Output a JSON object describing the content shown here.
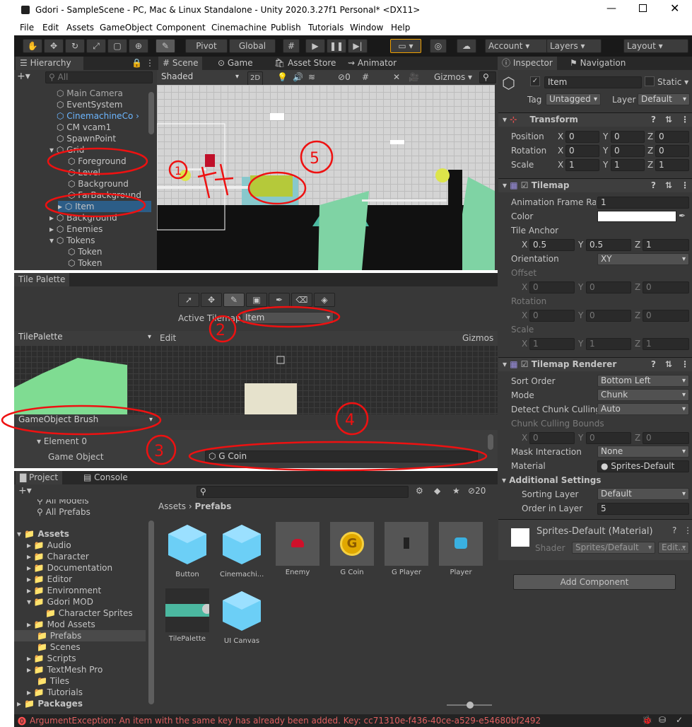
{
  "title": "Gdori - SampleScene - PC, Mac & Linux Standalone - Unity 2020.3.27f1 Personal* <DX11>",
  "menu": [
    "File",
    "Edit",
    "Assets",
    "GameObject",
    "Component",
    "Cinemachine",
    "Publish",
    "Tutorials",
    "Window",
    "Help"
  ],
  "toolbar": {
    "pivot": "Pivot",
    "global": "Global",
    "account": "Account",
    "layers": "Layers",
    "layout": "Layout"
  },
  "hierarchy": {
    "tab": "Hierarchy",
    "search": "All",
    "items": [
      "Main Camera",
      "EventSystem",
      "CinemachineCo",
      "CM vcam1",
      "SpawnPoint",
      "Grid",
      "Foreground",
      "Level",
      "Background",
      "FarBackground",
      "Item",
      "Background",
      "Enemies",
      "Tokens",
      "Token",
      "Token"
    ]
  },
  "scene": {
    "tabs": [
      "Scene",
      "Game",
      "Asset Store",
      "Animator"
    ],
    "shaded": "Shaded",
    "mode2d": "2D",
    "gizmos": "Gizmos",
    "hidden": "0"
  },
  "palette": {
    "tab": "Tile Palette",
    "active_label": "Active Tilemap",
    "active_value": "Item",
    "palette_name": "TilePalette",
    "edit": "Edit",
    "gizmos": "Gizmos",
    "brush": "GameObject Brush",
    "element": "Element 0",
    "game_object_label": "Game Object",
    "game_object_value": "G Coin"
  },
  "project": {
    "tabs": [
      "Project",
      "Console"
    ],
    "count": "20",
    "tree": [
      "All Models",
      "All Prefabs",
      "Assets",
      "Audio",
      "Character",
      "Documentation",
      "Editor",
      "Environment",
      "Gdori MOD",
      "Character Sprites",
      "Mod Assets",
      "Prefabs",
      "Scenes",
      "Scripts",
      "TextMesh Pro",
      "Tiles",
      "Tutorials",
      "Packages"
    ],
    "breadcrumb_root": "Assets",
    "breadcrumb_leaf": "Prefabs",
    "assets": [
      "Button",
      "Cinemachi...",
      "Enemy",
      "G Coin",
      "G Player",
      "Player",
      "TilePalette",
      "UI Canvas"
    ]
  },
  "inspector": {
    "tabs": [
      "Inspector",
      "Navigation"
    ],
    "name": "Item",
    "static": "Static",
    "tag_label": "Tag",
    "tag": "Untagged",
    "layer_label": "Layer",
    "layer": "Default",
    "transform": {
      "title": "Transform",
      "position": "Position",
      "rotation": "Rotation",
      "scale": "Scale",
      "pos": [
        "0",
        "0",
        "0"
      ],
      "rot": [
        "0",
        "0",
        "0"
      ],
      "scl": [
        "1",
        "1",
        "1"
      ]
    },
    "tilemap": {
      "title": "Tilemap",
      "anim_label": "Animation Frame Rate",
      "anim": "1",
      "color_label": "Color",
      "anchor_label": "Tile Anchor",
      "anchor": [
        "0.5",
        "0.5",
        "1"
      ],
      "orientation_label": "Orientation",
      "orientation": "XY",
      "offset_label": "Offset",
      "offset": [
        "0",
        "0",
        "0"
      ],
      "rotation_label": "Rotation",
      "rotation": [
        "0",
        "0",
        "0"
      ],
      "scale_label": "Scale",
      "scale": [
        "1",
        "1",
        "1"
      ]
    },
    "renderer": {
      "title": "Tilemap Renderer",
      "sort_label": "Sort Order",
      "sort": "Bottom Left",
      "mode_label": "Mode",
      "mode": "Chunk",
      "detect_label": "Detect Chunk Culling",
      "detect": "Auto",
      "bounds_label": "Chunk Culling Bounds",
      "bounds": [
        "0",
        "0",
        "0"
      ],
      "mask_label": "Mask Interaction",
      "mask": "None",
      "material_label": "Material",
      "material": "Sprites-Default"
    },
    "additional": {
      "title": "Additional Settings",
      "sorting_label": "Sorting Layer",
      "sorting": "Default",
      "order_label": "Order in Layer",
      "order": "5"
    },
    "material_block": {
      "title": "Sprites-Default (Material)",
      "shader_label": "Shader",
      "shader": "Sprites/Default",
      "edit": "Edit..."
    },
    "add_component": "Add Component"
  },
  "status": "ArgumentException: An item with the same key has already been added. Key: cc71310e-f436-40ce-a529-e54680bf2492",
  "annotations": [
    "1",
    "2",
    "3",
    "4",
    "5"
  ]
}
